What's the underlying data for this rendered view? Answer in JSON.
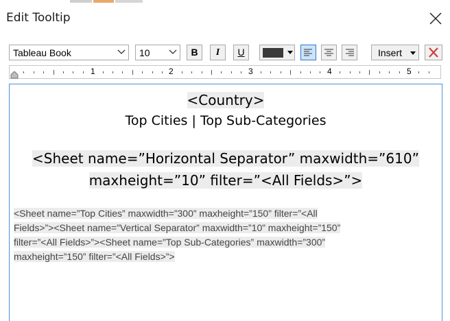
{
  "window": {
    "title": "Edit Tooltip",
    "close_icon": "close-icon"
  },
  "toolbar": {
    "font_family": "Tableau Book",
    "font_size": "10",
    "bold_label": "B",
    "italic_label": "I",
    "underline_label": "U",
    "text_color": "#3a3a3a",
    "align_left_icon": "align-left-icon",
    "align_center_icon": "align-center-icon",
    "align_right_icon": "align-right-icon",
    "active_alignment": "left",
    "insert_label": "Insert",
    "clear_icon": "clear-formatting-icon",
    "clear_color": "#d0403a"
  },
  "ruler": {
    "numbers": [
      "1",
      "2",
      "3",
      "4",
      "5"
    ]
  },
  "editor": {
    "line_country": "<Country>",
    "top_cities": "Top Cities",
    "separator_bar": "|",
    "top_subcategories": "Top Sub-Categories",
    "sheet_separator_line1": "<Sheet name=”Horizontal Separator” maxwidth=”610”",
    "sheet_separator_line2": "maxheight=”10” filter=”<All Fields>”>",
    "sheets_lines": [
      "<Sheet name=”Top Cities” maxwidth=”300” maxheight=”150” filter=”<All",
      "Fields>”><Sheet name=”Vertical Separator” maxwidth=”10” maxheight=”150”",
      "filter=”<All Fields>”><Sheet name=”Top Sub-Categories” maxwidth=”300”",
      "maxheight=”150” filter=”<All Fields>”>"
    ],
    "highlight_color": "#ececec",
    "border_color": "#4a90d9"
  }
}
